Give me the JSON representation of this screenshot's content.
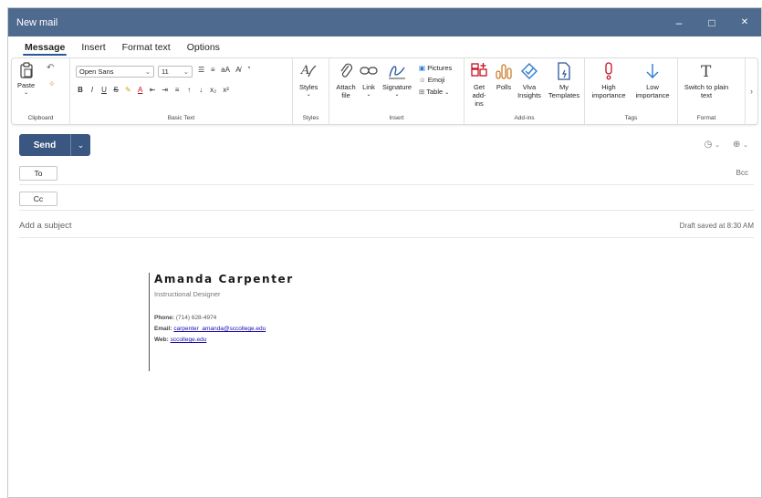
{
  "window": {
    "title": "New mail",
    "minimize": "–",
    "maximize": "□",
    "close": "✕"
  },
  "tabs": [
    "Message",
    "Insert",
    "Format text",
    "Options"
  ],
  "ribbon": {
    "clipboard": {
      "paste": "Paste",
      "label": "Clipboard"
    },
    "basic_text": {
      "font": "Open Sans",
      "size": "11",
      "label": "Basic Text",
      "row1_icons": [
        "☰",
        "≡",
        "aA",
        "A̸",
        "”"
      ],
      "row2_icons": [
        "B",
        "I",
        "U",
        "S",
        "✎",
        "A",
        "⇤",
        "⇥",
        "≡",
        "↑",
        "↓",
        "x₂",
        "x²"
      ]
    },
    "styles": {
      "button": "Styles",
      "label": "Styles"
    },
    "insert": {
      "attach": "Attach file",
      "link": "Link",
      "signature": "Signature",
      "pictures": "Pictures",
      "emoji": "Emoji",
      "table": "Table",
      "label": "Insert"
    },
    "addins": {
      "get_addins": "Get add-ins",
      "polls": "Polls",
      "viva": "Viva Insights",
      "templates": "My Templates",
      "label": "Add-ins"
    },
    "tags": {
      "high": "High importance",
      "low": "Low importance",
      "label": "Tags"
    },
    "format": {
      "switch": "Switch to plain text",
      "label": "Format"
    }
  },
  "compose": {
    "send": "Send",
    "to": "To",
    "cc": "Cc",
    "bcc": "Bcc",
    "subject_placeholder": "Add a subject",
    "draft_status": "Draft saved at 8:30 AM"
  },
  "signature": {
    "name": "Amanda Carpenter",
    "title": "Instructional Designer",
    "phone_label": "Phone:",
    "phone": "(714) 628-4974",
    "email_label": "Email:",
    "email": "carpenter_amanda@sccollege.edu",
    "web_label": "Web:",
    "web": "sccollege.edu"
  },
  "colors": {
    "titlebar": "#4f6a8f",
    "accent": "#395780",
    "link": "#1a0dab",
    "high_importance": "#c50f1f",
    "low_importance": "#2b7cd3"
  }
}
